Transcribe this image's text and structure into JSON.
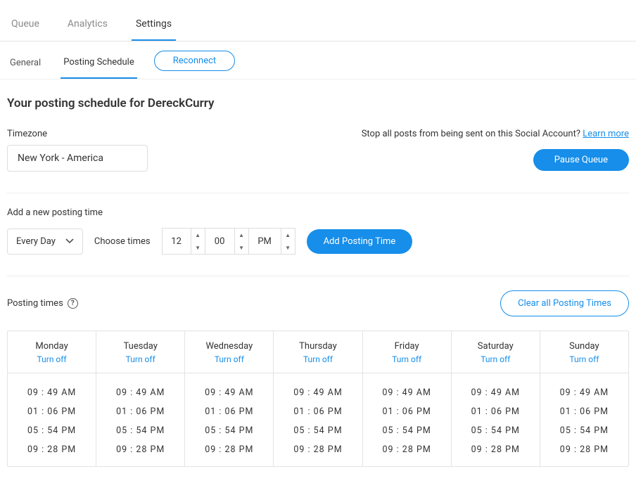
{
  "mainTabs": {
    "queue": "Queue",
    "analytics": "Analytics",
    "settings": "Settings"
  },
  "subTabs": {
    "general": "General",
    "posting": "Posting Schedule",
    "reconnect": "Reconnect"
  },
  "heading": "Your posting schedule for DereckCurry",
  "timezone": {
    "label": "Timezone",
    "value": "New York - America"
  },
  "stopArea": {
    "message": "Stop all posts from being sent on this Social Account? ",
    "learnMore": "Learn more",
    "pause": "Pause Queue"
  },
  "addTime": {
    "sectionLabel": "Add a new posting time",
    "daySelector": "Every Day",
    "chooseLabel": "Choose times",
    "hour": "12",
    "minute": "00",
    "ampm": "PM",
    "addBtn": "Add Posting Time"
  },
  "postingTimes": {
    "label": "Posting times",
    "clearBtn": "Clear all Posting Times",
    "turnOff": "Turn off",
    "days": [
      "Monday",
      "Tuesday",
      "Wednesday",
      "Thursday",
      "Friday",
      "Saturday",
      "Sunday"
    ],
    "slots": [
      "09 : 49  AM",
      "01 : 06  PM",
      "05 : 54  PM",
      "09 : 28  PM"
    ]
  }
}
